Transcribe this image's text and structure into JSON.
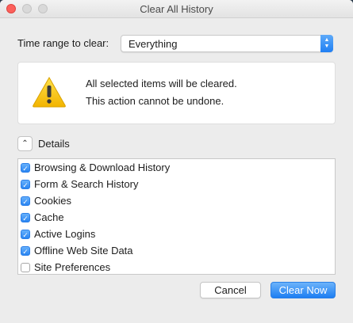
{
  "window": {
    "title": "Clear All History"
  },
  "time_range": {
    "label": "Time range to clear:",
    "selected": "Everything"
  },
  "warning": {
    "line1": "All selected items will be cleared.",
    "line2": "This action cannot be undone."
  },
  "details": {
    "label": "Details",
    "toggle_glyph": "⌃"
  },
  "items": [
    {
      "label": "Browsing & Download History",
      "checked": true
    },
    {
      "label": "Form & Search History",
      "checked": true
    },
    {
      "label": "Cookies",
      "checked": true
    },
    {
      "label": "Cache",
      "checked": true
    },
    {
      "label": "Active Logins",
      "checked": true
    },
    {
      "label": "Offline Web Site Data",
      "checked": true
    },
    {
      "label": "Site Preferences",
      "checked": false
    }
  ],
  "buttons": {
    "cancel": "Cancel",
    "clear": "Clear Now"
  },
  "colors": {
    "accent": "#1f7ff3",
    "close": "#fc605b",
    "warning": "#f5c300"
  }
}
